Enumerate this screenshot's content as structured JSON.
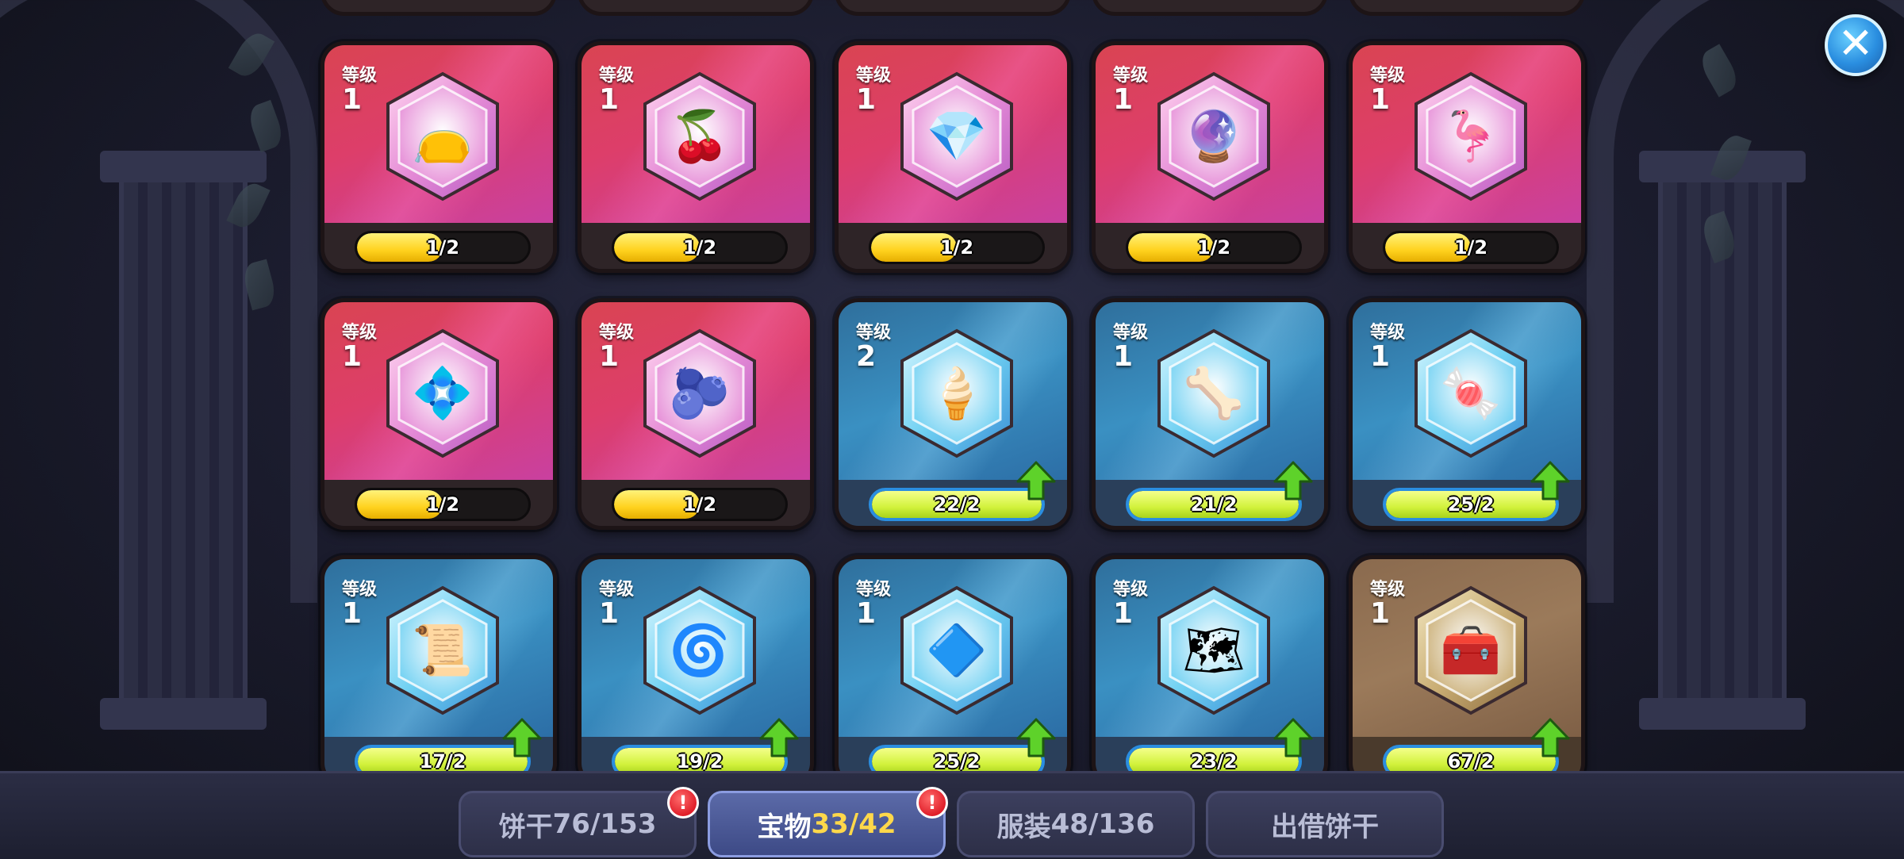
{
  "level_label": "等级",
  "close_icon": "close-icon",
  "cards": [
    {
      "theme": "pink",
      "level": "1",
      "progress": "1/2",
      "fill": 0.5,
      "icon": "vine-pouch",
      "glyph": "👝",
      "arrow": false
    },
    {
      "theme": "pink",
      "level": "1",
      "progress": "1/2",
      "fill": 0.5,
      "icon": "cherry-berries",
      "glyph": "🍒",
      "arrow": false
    },
    {
      "theme": "pink",
      "level": "1",
      "progress": "1/2",
      "fill": 0.5,
      "icon": "ice-crystal",
      "glyph": "💎",
      "arrow": false
    },
    {
      "theme": "pink",
      "level": "1",
      "progress": "1/2",
      "fill": 0.5,
      "icon": "golden-mirror",
      "glyph": "🔮",
      "arrow": false
    },
    {
      "theme": "pink",
      "level": "1",
      "progress": "1/2",
      "fill": 0.5,
      "icon": "pink-flamingo",
      "glyph": "🦩",
      "arrow": false
    },
    {
      "theme": "pink",
      "level": "1",
      "progress": "1/2",
      "fill": 0.5,
      "icon": "sparkling-gem",
      "glyph": "💠",
      "arrow": false
    },
    {
      "theme": "pink",
      "level": "1",
      "progress": "1/2",
      "fill": 0.5,
      "icon": "blue-pouch",
      "glyph": "🫐",
      "arrow": false
    },
    {
      "theme": "blue",
      "level": "2",
      "progress": "22/2",
      "fill": 1,
      "icon": "ice-cream-cone",
      "glyph": "🍦",
      "arrow": true
    },
    {
      "theme": "blue",
      "level": "1",
      "progress": "21/2",
      "fill": 1,
      "icon": "bone-scythe",
      "glyph": "🦴",
      "arrow": true
    },
    {
      "theme": "blue",
      "level": "1",
      "progress": "25/2",
      "fill": 1,
      "icon": "pink-candy",
      "glyph": "🍬",
      "arrow": true
    },
    {
      "theme": "blue",
      "level": "1",
      "progress": "17/2",
      "fill": 1,
      "icon": "red-scroll",
      "glyph": "📜",
      "arrow": true
    },
    {
      "theme": "blue",
      "level": "1",
      "progress": "19/2",
      "fill": 1,
      "icon": "swirl-orb",
      "glyph": "🌀",
      "arrow": true
    },
    {
      "theme": "blue",
      "level": "1",
      "progress": "25/2",
      "fill": 1,
      "icon": "dark-crystal",
      "glyph": "🔷",
      "arrow": true
    },
    {
      "theme": "blue",
      "level": "1",
      "progress": "23/2",
      "fill": 1,
      "icon": "map-scroll",
      "glyph": "🗺",
      "arrow": true
    },
    {
      "theme": "brown",
      "level": "1",
      "progress": "67/2",
      "fill": 1,
      "icon": "treasure-chest",
      "glyph": "🧰",
      "arrow": true
    }
  ],
  "tabs": [
    {
      "label": "饼干",
      "count": "76/153",
      "badge": "!",
      "active": false
    },
    {
      "label": "宝物",
      "count": "33/42",
      "badge": "!",
      "active": true
    },
    {
      "label": "服装",
      "count": "48/136",
      "badge": "",
      "active": false
    },
    {
      "label": "出借饼干",
      "count": "",
      "badge": "",
      "active": false
    }
  ]
}
